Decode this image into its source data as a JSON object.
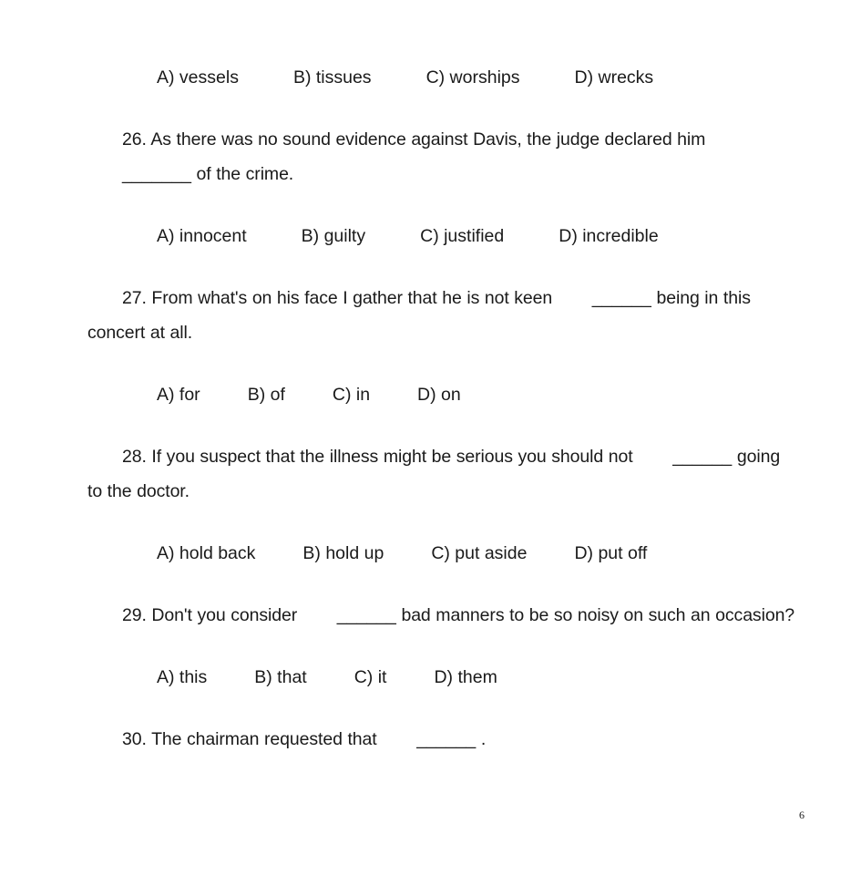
{
  "document": {
    "page_number": "6",
    "blank_marker": "_______"
  },
  "blocks": [
    {
      "kind": "options",
      "name": "options-row-25",
      "items": [
        "A) vessels",
        "B) tissues",
        "C) worships",
        "D) wrecks"
      ]
    },
    {
      "kind": "question",
      "name": "question-26",
      "number": "26.",
      "text_before": "26. As there was no sound evidence against Davis, the judge declared him ",
      "blank": "_______",
      "text_after": " of the crime."
    },
    {
      "kind": "options",
      "name": "options-row-26",
      "items": [
        "A) innocent",
        "B) guilty",
        "C) justified",
        "D) incredible"
      ]
    },
    {
      "kind": "question",
      "name": "question-27",
      "number": "27.",
      "text_before": "27. From what's on his face I gather that he is not keen ",
      "blank": "______",
      "text_after": " being in this concert at all."
    },
    {
      "kind": "options",
      "name": "options-row-27",
      "items": [
        "A) for",
        "B) of",
        "C) in",
        "D) on"
      ]
    },
    {
      "kind": "question",
      "name": "question-28",
      "number": "28.",
      "text_before": "28. If you suspect that the illness might be serious you should not ",
      "blank": "______",
      "text_after": " going to the doctor."
    },
    {
      "kind": "options",
      "name": "options-row-28",
      "items": [
        "A) hold back",
        "B) hold up",
        "C) put aside",
        "D) put off"
      ]
    },
    {
      "kind": "question",
      "name": "question-29",
      "number": "29.",
      "text_before": "29. Don't you consider ",
      "blank": "______",
      "text_after": " bad manners to be so noisy on such an occasion?"
    },
    {
      "kind": "options",
      "name": "options-row-29",
      "items": [
        "A) this",
        "B) that",
        "C) it",
        "D) them"
      ]
    },
    {
      "kind": "question",
      "name": "question-30",
      "number": "30.",
      "text_before": "30. The chairman requested that ",
      "blank": "______",
      "text_after": " ."
    }
  ]
}
